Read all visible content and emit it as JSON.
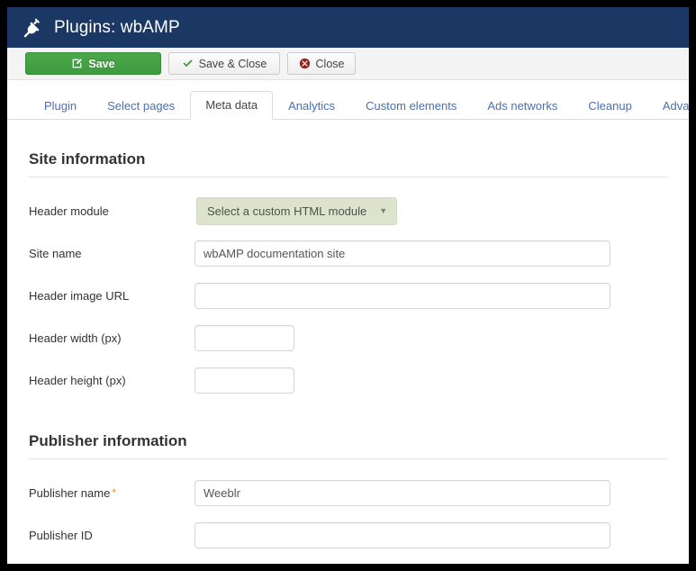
{
  "window": {
    "title": "Plugins: wbAMP",
    "icon": "plug-icon",
    "header_color": "#1b3764"
  },
  "toolbar": {
    "buttons": [
      {
        "label": "Save",
        "icon": "edit-square-icon",
        "style": "primary",
        "color": "#41a041"
      },
      {
        "label": "Save & Close",
        "icon": "check-icon",
        "style": "default",
        "icon_color": "#3e9a3e"
      },
      {
        "label": "Close",
        "icon": "cancel-circle-icon",
        "style": "default",
        "icon_color": "#a02020"
      }
    ]
  },
  "tabs": [
    {
      "label": "Plugin",
      "active": false
    },
    {
      "label": "Select pages",
      "active": false
    },
    {
      "label": "Meta data",
      "active": true
    },
    {
      "label": "Analytics",
      "active": false
    },
    {
      "label": "Custom elements",
      "active": false
    },
    {
      "label": "Ads networks",
      "active": false
    },
    {
      "label": "Cleanup",
      "active": false
    },
    {
      "label": "Advanced",
      "active": false
    }
  ],
  "sections": [
    {
      "title": "Site information",
      "fields": [
        {
          "label": "Header module",
          "type": "select",
          "value": "Select a custom HTML module",
          "caret": "▼"
        },
        {
          "label": "Site name",
          "type": "text",
          "size": "wide",
          "value": "wbAMP documentation site",
          "placeholder": ""
        },
        {
          "label": "Header image URL",
          "type": "text",
          "size": "wide",
          "value": "",
          "placeholder": ""
        },
        {
          "label": "Header width (px)",
          "type": "text",
          "size": "small",
          "value": "",
          "placeholder": ""
        },
        {
          "label": "Header height (px)",
          "type": "text",
          "size": "small",
          "value": "",
          "placeholder": ""
        }
      ]
    },
    {
      "title": "Publisher information",
      "fields": [
        {
          "label": "Publisher name",
          "required": true,
          "required_marker": "*",
          "type": "text",
          "size": "wide",
          "value": "Weeblr",
          "placeholder": ""
        },
        {
          "label": "Publisher ID",
          "type": "text",
          "size": "wide",
          "value": "",
          "placeholder": ""
        }
      ]
    }
  ]
}
